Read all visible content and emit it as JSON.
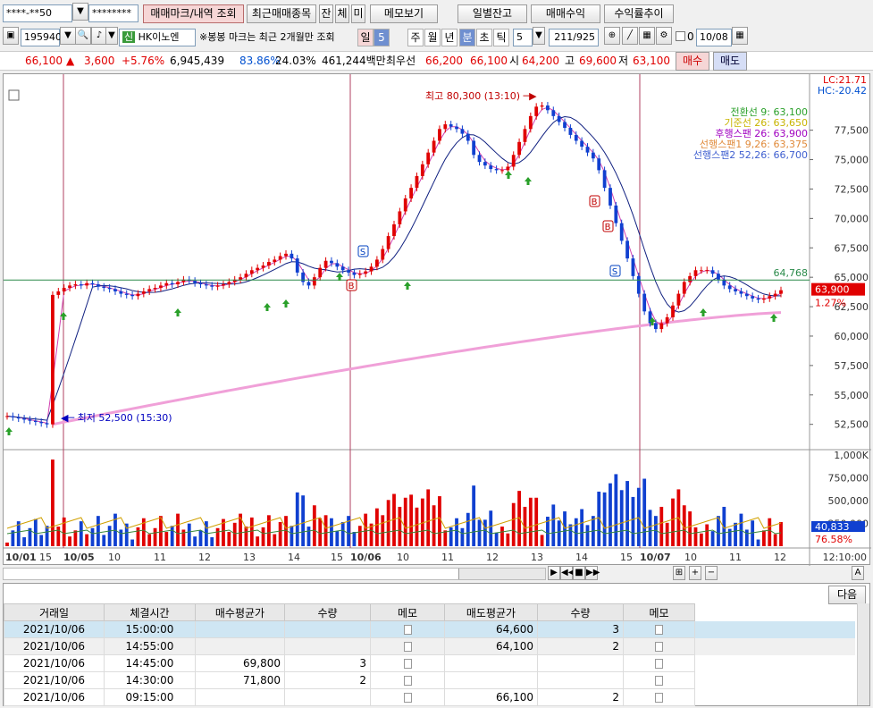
{
  "toolbar1": {
    "account": "****-**50",
    "password": "********",
    "buttons": [
      "매매마크/내역 조회",
      "최근매매종목",
      "잔",
      "체",
      "미",
      "메모보기",
      "일별잔고",
      "매매수익",
      "수익률추이"
    ]
  },
  "toolbar2": {
    "code": "195940",
    "name": "HK이노엔",
    "name_prefix": "신",
    "notice": "※봉봉 마크는 최근 2개월만 조회",
    "period_label": "일",
    "period_value": "5",
    "periods": [
      "주",
      "월",
      "년",
      "분",
      "초",
      "틱"
    ],
    "active_period": "분",
    "interval": "5",
    "count": "211/925",
    "checkbox_label": "0",
    "date": "10/08"
  },
  "quote": {
    "price": "66,100",
    "change_arrow": "▲",
    "change": "3,600",
    "change_pct": "+5.76%",
    "volume": "6,945,439",
    "vol_ratio": "83.86%",
    "turnover": "24.03%",
    "amount": "461,244백만",
    "best_label": "최우선",
    "ask": "66,200",
    "bid": "66,100",
    "open_label": "시",
    "open": "64,200",
    "high_label": "고",
    "high": "69,600",
    "low_label": "저",
    "low": "63,100",
    "buy_btn": "매수",
    "sell_btn": "매도"
  },
  "chart_data": {
    "type": "candlestick",
    "interval": "5분",
    "price_axis": {
      "ticks": [
        52500,
        55000,
        57500,
        60000,
        62500,
        65000,
        67500,
        70000,
        72500,
        75000,
        77500
      ],
      "range": [
        50500,
        81500
      ]
    },
    "volume_axis": {
      "ticks": [
        "1,000K",
        "750,000",
        "500,000",
        "250,000"
      ],
      "range": [
        0,
        1000000
      ]
    },
    "x_ticks": [
      "10/01",
      "15",
      "10/05",
      "10",
      "11",
      "12",
      "13",
      "14",
      "15",
      "10/06",
      "10",
      "11",
      "12",
      "13",
      "14",
      "15",
      "10/07",
      "10",
      "11",
      "12"
    ],
    "time_label": "12:10:00",
    "legend": [
      {
        "label": "전환선 9: 63,100",
        "color": "#2aa02a"
      },
      {
        "label": "기준선 26: 63,650",
        "color": "#c8b400"
      },
      {
        "label": "후행스팬 26: 63,900",
        "color": "#a000c0"
      },
      {
        "label": "선행스팬1 9,26: 63,375",
        "color": "#e08a3a"
      },
      {
        "label": "선행스팬2 52,26: 66,700",
        "color": "#4060d0"
      }
    ],
    "lc": "LC:21.71",
    "hc": "HC:-20.42",
    "hline": {
      "value": 64768,
      "label": "64,768",
      "color": "#2a8a4a"
    },
    "current": {
      "value": 63900,
      "label": "63,900",
      "pct": "1.27%"
    },
    "high_mark": {
      "label": "최고 80,300 (13:10)",
      "value": 80300
    },
    "low_mark": {
      "label": "최저 52,500 (15:30)",
      "value": 52500
    },
    "volume_current": {
      "label": "40,833",
      "pct": "76.58%"
    },
    "price_series": [
      53200,
      53100,
      53000,
      52900,
      52800,
      52700,
      52600,
      52500,
      63500,
      63800,
      64100,
      64300,
      64400,
      64300,
      64500,
      64400,
      64200,
      64100,
      64000,
      63800,
      63600,
      63500,
      63400,
      63600,
      63800,
      64000,
      64100,
      64300,
      64500,
      64400,
      64600,
      64800,
      64700,
      64500,
      64400,
      64300,
      64200,
      64300,
      64400,
      64600,
      64800,
      65000,
      65300,
      65600,
      65800,
      66000,
      66300,
      66500,
      66800,
      67000,
      66600,
      65400,
      64600,
      64300,
      65000,
      65800,
      66400,
      66200,
      65900,
      65600,
      65400,
      65200,
      65300,
      65500,
      65900,
      66500,
      67400,
      68500,
      69500,
      70600,
      71700,
      72600,
      73600,
      74600,
      75600,
      76600,
      77600,
      78000,
      77800,
      77600,
      77200,
      76600,
      75400,
      74800,
      74500,
      74200,
      74100,
      74100,
      74400,
      75400,
      76500,
      77600,
      78700,
      79500,
      79600,
      79200,
      78700,
      78200,
      77700,
      77100,
      76600,
      76100,
      75600,
      75100,
      74100,
      72600,
      71100,
      69600,
      68100,
      66600,
      65100,
      63600,
      62100,
      61100,
      60600,
      61100,
      61600,
      62600,
      63600,
      64600,
      65100,
      65600,
      65600,
      65600,
      65300,
      64800,
      64300,
      64000,
      63800,
      63600,
      63400,
      63200,
      63100,
      63200,
      63400,
      63600,
      63900
    ]
  },
  "nav": {
    "next_btn": "다음"
  },
  "table": {
    "headers": [
      "거래일",
      "체결시간",
      "매수평균가",
      "수량",
      "메모",
      "매도평균가",
      "수량",
      "메모"
    ],
    "rows": [
      [
        "2021/10/06",
        "15:00:00",
        "",
        "",
        "",
        "64,600",
        "3",
        ""
      ],
      [
        "2021/10/06",
        "14:55:00",
        "",
        "",
        "",
        "64,100",
        "2",
        ""
      ],
      [
        "2021/10/06",
        "14:45:00",
        "69,800",
        "3",
        "",
        "",
        "",
        ""
      ],
      [
        "2021/10/06",
        "14:30:00",
        "71,800",
        "2",
        "",
        "",
        "",
        ""
      ],
      [
        "2021/10/06",
        "09:15:00",
        "",
        "",
        "",
        "66,100",
        "2",
        ""
      ]
    ]
  },
  "colors": {
    "up": "#e00000",
    "down": "#1040d0",
    "cloud": "#f0a0d8"
  }
}
